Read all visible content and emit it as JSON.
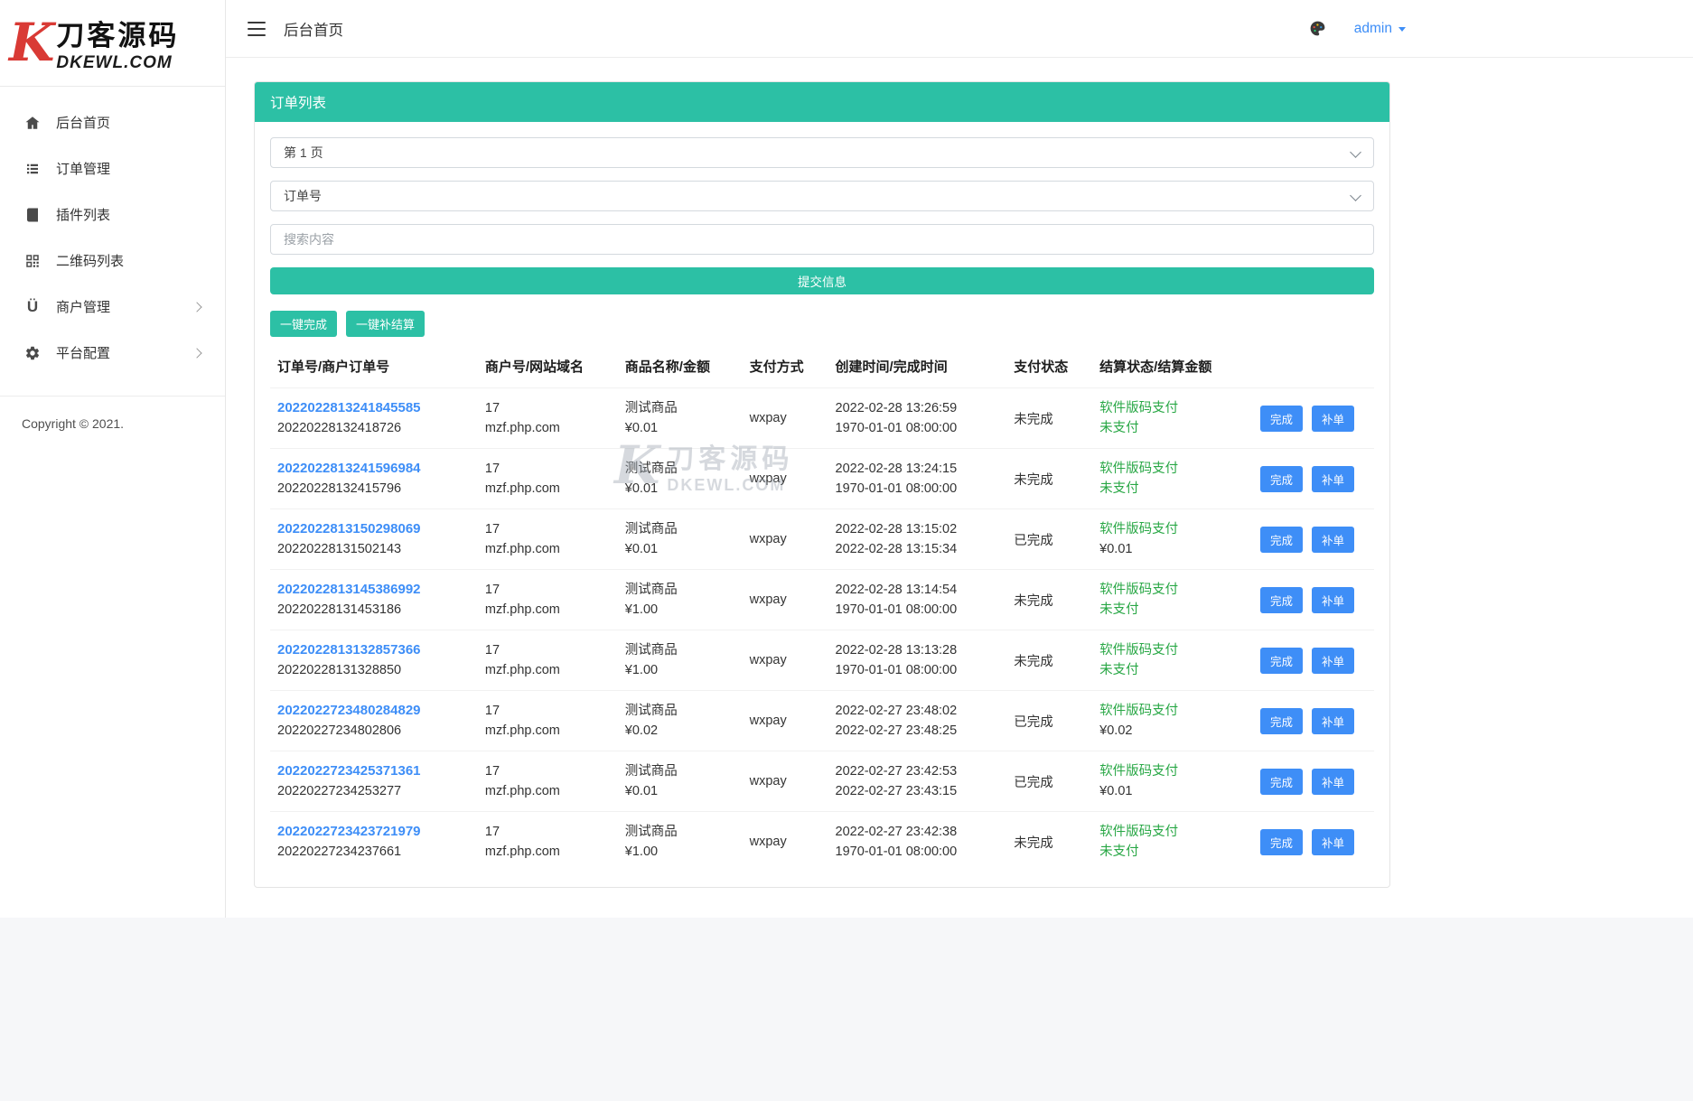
{
  "colors": {
    "teal": "#2cc0a5",
    "blue": "#3e8ef7",
    "green": "#28a745",
    "logo_red": "#d93a35"
  },
  "brand": {
    "initial": "K",
    "title": "刀客源码",
    "sub": "DKEWL.COM"
  },
  "topbar": {
    "title": "后台首页",
    "user": "admin"
  },
  "sidebar": {
    "items": [
      {
        "label": "后台首页",
        "icon": "home-icon",
        "expandable": false
      },
      {
        "label": "订单管理",
        "icon": "list-icon",
        "expandable": false
      },
      {
        "label": "插件列表",
        "icon": "book-icon",
        "expandable": false
      },
      {
        "label": "二维码列表",
        "icon": "qrcode-icon",
        "expandable": false
      },
      {
        "label": "商户管理",
        "icon": "merchant-icon",
        "expandable": true
      },
      {
        "label": "平台配置",
        "icon": "gear-icon",
        "expandable": true
      }
    ],
    "copyright": "Copyright © 2021."
  },
  "panel": {
    "title": "订单列表",
    "page_select_value": "第 1 页",
    "field_select_value": "订单号",
    "search_placeholder": "搜索内容",
    "submit_label": "提交信息",
    "bulk_complete_label": "一键完成",
    "bulk_settle_label": "一键补结算"
  },
  "table": {
    "headers": [
      "订单号/商户订单号",
      "商户号/网站域名",
      "商品名称/金额",
      "支付方式",
      "创建时间/完成时间",
      "支付状态",
      "结算状态/结算金额",
      ""
    ],
    "action_complete": "完成",
    "action_supplement": "补单",
    "rows": [
      {
        "order_no": "2022022813241845585",
        "merchant_order_no": "20220228132418726",
        "merchant_id": "17",
        "domain": "mzf.php.com",
        "product": "测试商品",
        "amount": "¥0.01",
        "pay_method": "wxpay",
        "created": "2022-02-28 13:26:59",
        "completed": "1970-01-01 08:00:00",
        "pay_status": "未完成",
        "settle_status": "软件版码支付",
        "settle_amount": "未支付"
      },
      {
        "order_no": "2022022813241596984",
        "merchant_order_no": "20220228132415796",
        "merchant_id": "17",
        "domain": "mzf.php.com",
        "product": "测试商品",
        "amount": "¥0.01",
        "pay_method": "wxpay",
        "created": "2022-02-28 13:24:15",
        "completed": "1970-01-01 08:00:00",
        "pay_status": "未完成",
        "settle_status": "软件版码支付",
        "settle_amount": "未支付"
      },
      {
        "order_no": "2022022813150298069",
        "merchant_order_no": "20220228131502143",
        "merchant_id": "17",
        "domain": "mzf.php.com",
        "product": "测试商品",
        "amount": "¥0.01",
        "pay_method": "wxpay",
        "created": "2022-02-28 13:15:02",
        "completed": "2022-02-28 13:15:34",
        "pay_status": "已完成",
        "settle_status": "软件版码支付",
        "settle_amount": "¥0.01"
      },
      {
        "order_no": "2022022813145386992",
        "merchant_order_no": "20220228131453186",
        "merchant_id": "17",
        "domain": "mzf.php.com",
        "product": "测试商品",
        "amount": "¥1.00",
        "pay_method": "wxpay",
        "created": "2022-02-28 13:14:54",
        "completed": "1970-01-01 08:00:00",
        "pay_status": "未完成",
        "settle_status": "软件版码支付",
        "settle_amount": "未支付"
      },
      {
        "order_no": "2022022813132857366",
        "merchant_order_no": "20220228131328850",
        "merchant_id": "17",
        "domain": "mzf.php.com",
        "product": "测试商品",
        "amount": "¥1.00",
        "pay_method": "wxpay",
        "created": "2022-02-28 13:13:28",
        "completed": "1970-01-01 08:00:00",
        "pay_status": "未完成",
        "settle_status": "软件版码支付",
        "settle_amount": "未支付"
      },
      {
        "order_no": "2022022723480284829",
        "merchant_order_no": "20220227234802806",
        "merchant_id": "17",
        "domain": "mzf.php.com",
        "product": "测试商品",
        "amount": "¥0.02",
        "pay_method": "wxpay",
        "created": "2022-02-27 23:48:02",
        "completed": "2022-02-27 23:48:25",
        "pay_status": "已完成",
        "settle_status": "软件版码支付",
        "settle_amount": "¥0.02"
      },
      {
        "order_no": "2022022723425371361",
        "merchant_order_no": "20220227234253277",
        "merchant_id": "17",
        "domain": "mzf.php.com",
        "product": "测试商品",
        "amount": "¥0.01",
        "pay_method": "wxpay",
        "created": "2022-02-27 23:42:53",
        "completed": "2022-02-27 23:43:15",
        "pay_status": "已完成",
        "settle_status": "软件版码支付",
        "settle_amount": "¥0.01"
      },
      {
        "order_no": "2022022723423721979",
        "merchant_order_no": "20220227234237661",
        "merchant_id": "17",
        "domain": "mzf.php.com",
        "product": "测试商品",
        "amount": "¥1.00",
        "pay_method": "wxpay",
        "created": "2022-02-27 23:42:38",
        "completed": "1970-01-01 08:00:00",
        "pay_status": "未完成",
        "settle_status": "软件版码支付",
        "settle_amount": "未支付"
      }
    ]
  },
  "watermark": {
    "initial": "K",
    "title": "刀客源码",
    "sub": "DKEWL.COM"
  }
}
